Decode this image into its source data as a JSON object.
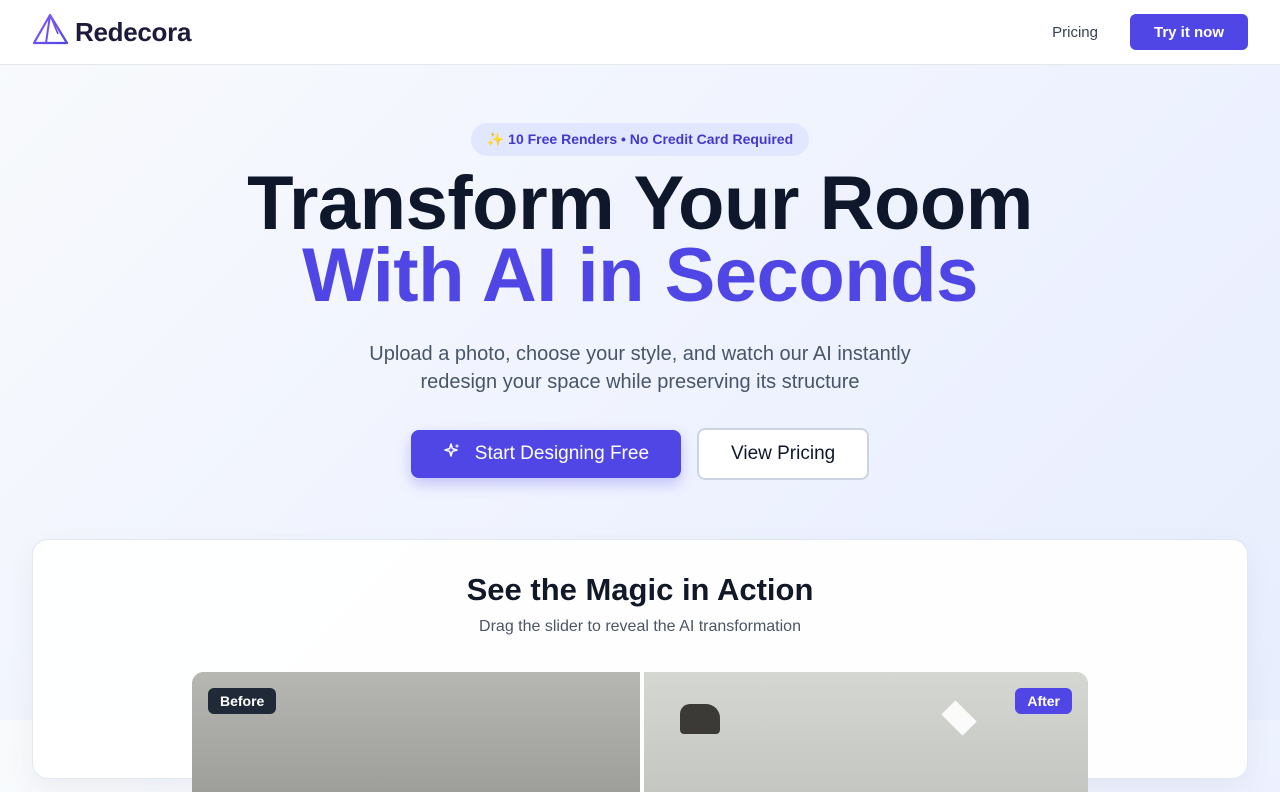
{
  "nav": {
    "brand": "Redecora",
    "pricing_link": "Pricing",
    "cta": "Try it now"
  },
  "hero": {
    "badge": "✨ 10 Free Renders • No Credit Card Required",
    "title_line1": "Transform Your Room",
    "title_line2": "With AI in Seconds",
    "subtitle": "Upload a photo, choose your style, and watch our AI instantly redesign your space while preserving its structure",
    "primary_cta": "Start Designing Free",
    "secondary_cta": "View Pricing"
  },
  "demo": {
    "title": "See the Magic in Action",
    "subtitle": "Drag the slider to reveal the AI transformation",
    "before_label": "Before",
    "after_label": "After"
  },
  "colors": {
    "accent": "#4f46e5",
    "heading": "#0f172a",
    "badge_bg": "#e0e7ff"
  },
  "icons": {
    "logo": "pyramid-logo-icon",
    "primary_cta": "sparkles-icon"
  }
}
